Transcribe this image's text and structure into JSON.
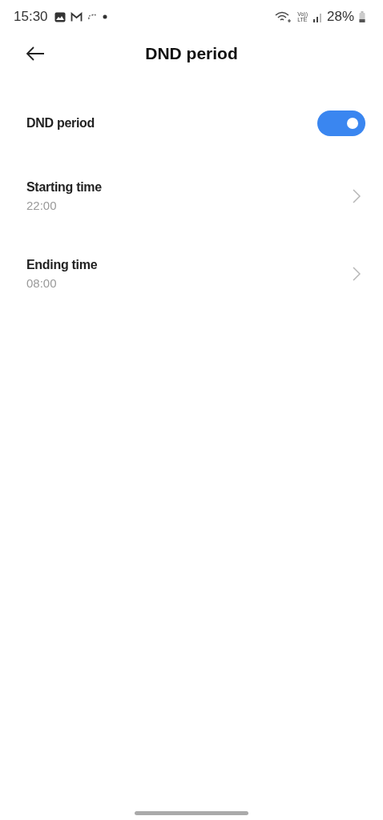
{
  "status_bar": {
    "time": "15:30",
    "volte_top": "Vo))",
    "volte_bottom": "LTE",
    "battery": "28%"
  },
  "header": {
    "title": "DND period"
  },
  "settings": [
    {
      "kind": "toggle",
      "label": "DND period",
      "on": true
    },
    {
      "kind": "link",
      "label": "Starting time",
      "value": "22:00"
    },
    {
      "kind": "link",
      "label": "Ending time",
      "value": "08:00"
    }
  ]
}
